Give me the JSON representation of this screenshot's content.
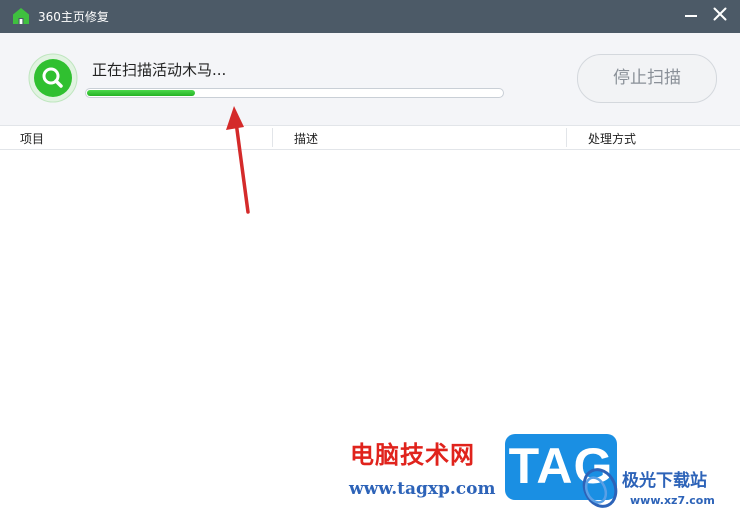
{
  "window": {
    "title": "360主页修复"
  },
  "scan": {
    "status_text": "正在扫描活动木马...",
    "progress": 0.26,
    "stop_label": "停止扫描"
  },
  "table": {
    "columns": [
      "项目",
      "描述",
      "处理方式"
    ]
  },
  "watermark": {
    "site_name": "电脑技术网",
    "site_url": "www.tagxp.com",
    "badge_text": "TAG",
    "site2_name": "极光下载站",
    "site2_url": "www.xz7.com"
  },
  "colors": {
    "titlebar": "#4c5a67",
    "progress": "#2cc02c",
    "annotation_arrow": "#d42a2a",
    "watermark_red": "#e0231c",
    "watermark_blue": "#1a8fe3"
  },
  "icons": {
    "app": "house-icon",
    "minimize": "minimize-icon",
    "close": "close-icon",
    "scan": "magnifier-icon"
  }
}
